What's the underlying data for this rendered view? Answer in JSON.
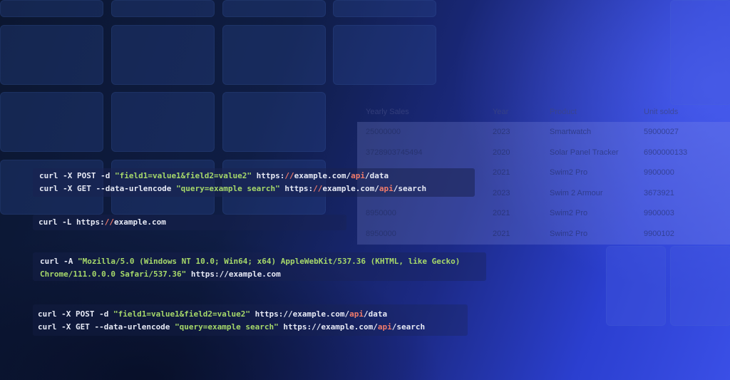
{
  "table": {
    "headers": [
      "Yearly Sales",
      "Year",
      "Product",
      "Unit solds"
    ],
    "rows": [
      [
        "25000000",
        "2023",
        "Smartwatch",
        "59000027"
      ],
      [
        "3728903745494",
        "2020",
        "Solar Panel Tracker",
        "6900000133"
      ],
      [
        "",
        "2021",
        "Swim2 Pro",
        "9900000"
      ],
      [
        "",
        "2023",
        "Swim 2 Armour",
        "3673921"
      ],
      [
        "8950000",
        "2021",
        "Swim2 Pro",
        "9900003"
      ],
      [
        "8950000",
        "2021",
        "Swim2 Pro",
        "9900102"
      ]
    ]
  },
  "code_blocks": [
    {
      "lines": [
        [
          {
            "t": "curl -X POST -d "
          },
          {
            "t": "\"field1=value1&field2=value2\"",
            "c": "str"
          },
          {
            "t": " https:"
          },
          {
            "t": "//",
            "c": "slash"
          },
          {
            "t": "example.com/"
          },
          {
            "t": "api",
            "c": "api"
          },
          {
            "t": "/data"
          }
        ],
        [
          {
            "t": "curl -X GET --data-urlencode "
          },
          {
            "t": "\"query=example search\"",
            "c": "str"
          },
          {
            "t": " https:"
          },
          {
            "t": "//",
            "c": "slash"
          },
          {
            "t": "example.com/"
          },
          {
            "t": "api",
            "c": "api"
          },
          {
            "t": "/search"
          }
        ]
      ]
    },
    {
      "lines": [
        [
          {
            "t": "curl -L https:"
          },
          {
            "t": "//",
            "c": "slash"
          },
          {
            "t": "example.com"
          }
        ]
      ]
    },
    {
      "lines": [
        [
          {
            "t": "curl -A "
          },
          {
            "t": "\"Mozilla/5.0 (Windows NT 10.0; Win64; x64) AppleWebKit/537.36 (KHTML, like Gecko)",
            "c": "str"
          }
        ],
        [
          {
            "t": "Chrome/111.0.0.0 Safari/537.36\"",
            "c": "str"
          },
          {
            "t": " https://example.com"
          }
        ]
      ]
    },
    {
      "lines": [
        [
          {
            "t": "curl -X POST -d "
          },
          {
            "t": "\"field1=value1&field2=value2\"",
            "c": "str"
          },
          {
            "t": " https://example.com/"
          },
          {
            "t": "api",
            "c": "api"
          },
          {
            "t": "/data"
          }
        ],
        [
          {
            "t": "curl -X GET --data-urlencode "
          },
          {
            "t": "\"query=example search\"",
            "c": "str"
          },
          {
            "t": " https://example.com/"
          },
          {
            "t": "api",
            "c": "api"
          },
          {
            "t": "/search"
          }
        ]
      ]
    }
  ]
}
